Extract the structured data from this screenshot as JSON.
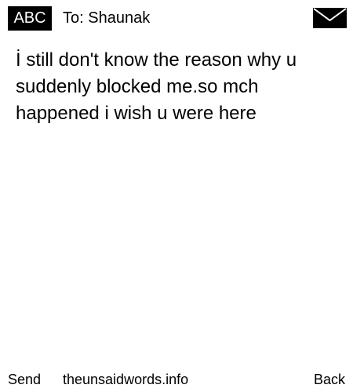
{
  "header": {
    "mode_label": "ABC",
    "recipient": "To: Shaunak",
    "icon": "envelope-icon"
  },
  "message": {
    "body": "İ still don't know the reason why u suddenly blocked me.so mch happened i wish u were here"
  },
  "softkeys": {
    "left": "Send",
    "center": "theunsaidwords.info",
    "right": "Back"
  },
  "colors": {
    "background": "#ffffff",
    "text": "#000000",
    "badge_background": "#000000",
    "badge_text": "#ffffff"
  }
}
